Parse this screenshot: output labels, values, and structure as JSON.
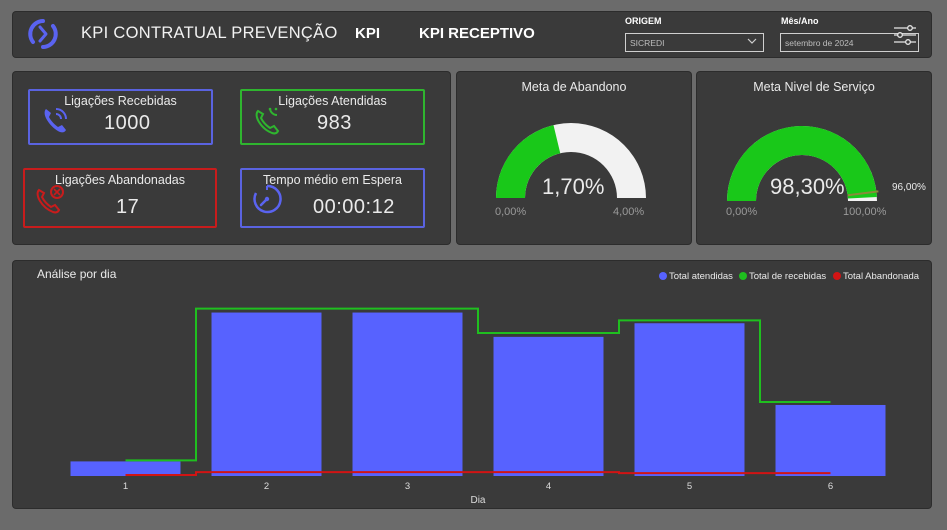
{
  "header": {
    "title": "KPI CONTRATUAL PREVENÇÃO",
    "nav": [
      "KPI",
      "KPI RECEPTIVO"
    ],
    "origem_label": "ORIGEM",
    "origem_value": "SICREDI",
    "mes_label": "Mês/Ano",
    "mes_value": "setembro de 2024"
  },
  "kpis": {
    "recebidas": {
      "label": "Ligações Recebidas",
      "value": "1000"
    },
    "atendidas": {
      "label": "Ligações Atendidas",
      "value": "983"
    },
    "abandonadas": {
      "label": "Ligações Abandonadas",
      "value": "17"
    },
    "espera": {
      "label": "Tempo médio em Espera",
      "value": "00:00:12"
    }
  },
  "gauges": {
    "abandono": {
      "title": "Meta de Abandono",
      "value_text": "1,70%",
      "min_text": "0,00%",
      "max_text": "4,00%",
      "value": 1.7,
      "min": 0,
      "max": 4
    },
    "servico": {
      "title": "Meta Nivel de Serviço",
      "value_text": "98,30%",
      "min_text": "0,00%",
      "max_text": "100,00%",
      "target_text": "96,00%",
      "value": 98.3,
      "min": 0,
      "max": 100,
      "target": 96
    }
  },
  "colors": {
    "atendidas": "#5762ff",
    "recebidas": "#1fbf1f",
    "abandonada": "#d11414",
    "gauge_fill": "#19c819",
    "gauge_bg": "#f2f2f2"
  },
  "chart_data": {
    "type": "bar",
    "title": "Análise por dia",
    "xlabel": "Dia",
    "ylabel": "",
    "categories": [
      "1",
      "2",
      "3",
      "4",
      "5",
      "6"
    ],
    "series": [
      {
        "name": "Total atendidas",
        "kind": "bar",
        "values": [
          15,
          168,
          168,
          143,
          157,
          73
        ]
      },
      {
        "name": "Total de recebidas",
        "kind": "step-line",
        "values": [
          16,
          172,
          172,
          147,
          160,
          76
        ]
      },
      {
        "name": "Total Abandonada",
        "kind": "step-line",
        "values": [
          1,
          4,
          4,
          4,
          3,
          3
        ]
      }
    ],
    "ylim": [
      0,
      185
    ],
    "legend": "top-right",
    "grid": false
  }
}
